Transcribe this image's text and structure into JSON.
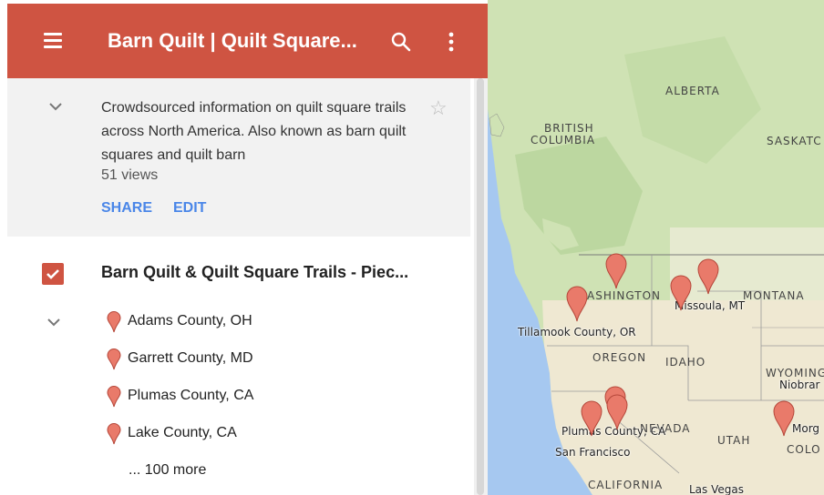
{
  "header": {
    "title": "Barn Quilt | Quilt Square...",
    "menu_icon": "menu-icon",
    "search_icon": "search-icon",
    "more_icon": "more-vert-icon",
    "brand_color": "#cf5442"
  },
  "description": {
    "text": "Crowdsourced information on quilt square trails across North America. Also known as barn quilt squares and quilt barn",
    "views": "51 views",
    "share_label": "SHARE",
    "edit_label": "EDIT",
    "link_color": "#4a86e8"
  },
  "layer": {
    "title": "Barn Quilt & Quilt Square Trails - Piec...",
    "checked": true,
    "items": [
      {
        "label": "Adams County, OH"
      },
      {
        "label": "Garrett County, MD"
      },
      {
        "label": "Plumas County, CA"
      },
      {
        "label": "Lake County, CA"
      }
    ],
    "more_label": "... 100 more",
    "pin_color": "#e97a6a"
  },
  "map": {
    "region_labels": {
      "alberta": "ALBERTA",
      "british_columbia_1": "BRITISH",
      "british_columbia_2": "COLUMBIA",
      "saskatchewan": "SASKATC",
      "washington": "ASHINGTON",
      "montana": "MONTANA",
      "oregon": "OREGON",
      "idaho": "IDAHO",
      "wyoming": "WYOMING",
      "nevada": "NEVADA",
      "utah": "UTAH",
      "colorado": "COLO",
      "california": "CALIFORNIA"
    },
    "city_labels": {
      "missoula": "Missoula, MT",
      "tillamook": "Tillamook County, OR",
      "plumas": "Plumas County, CA",
      "san_francisco": "San Francisco",
      "las_vegas": "Las Vegas",
      "niobrara": "Niobrar",
      "morgan": "Morg"
    },
    "colors": {
      "water": "#a6c8f0",
      "land_green": "#cfe2b4",
      "land_tan": "#efe8d2",
      "border": "#7a7a7a"
    }
  }
}
